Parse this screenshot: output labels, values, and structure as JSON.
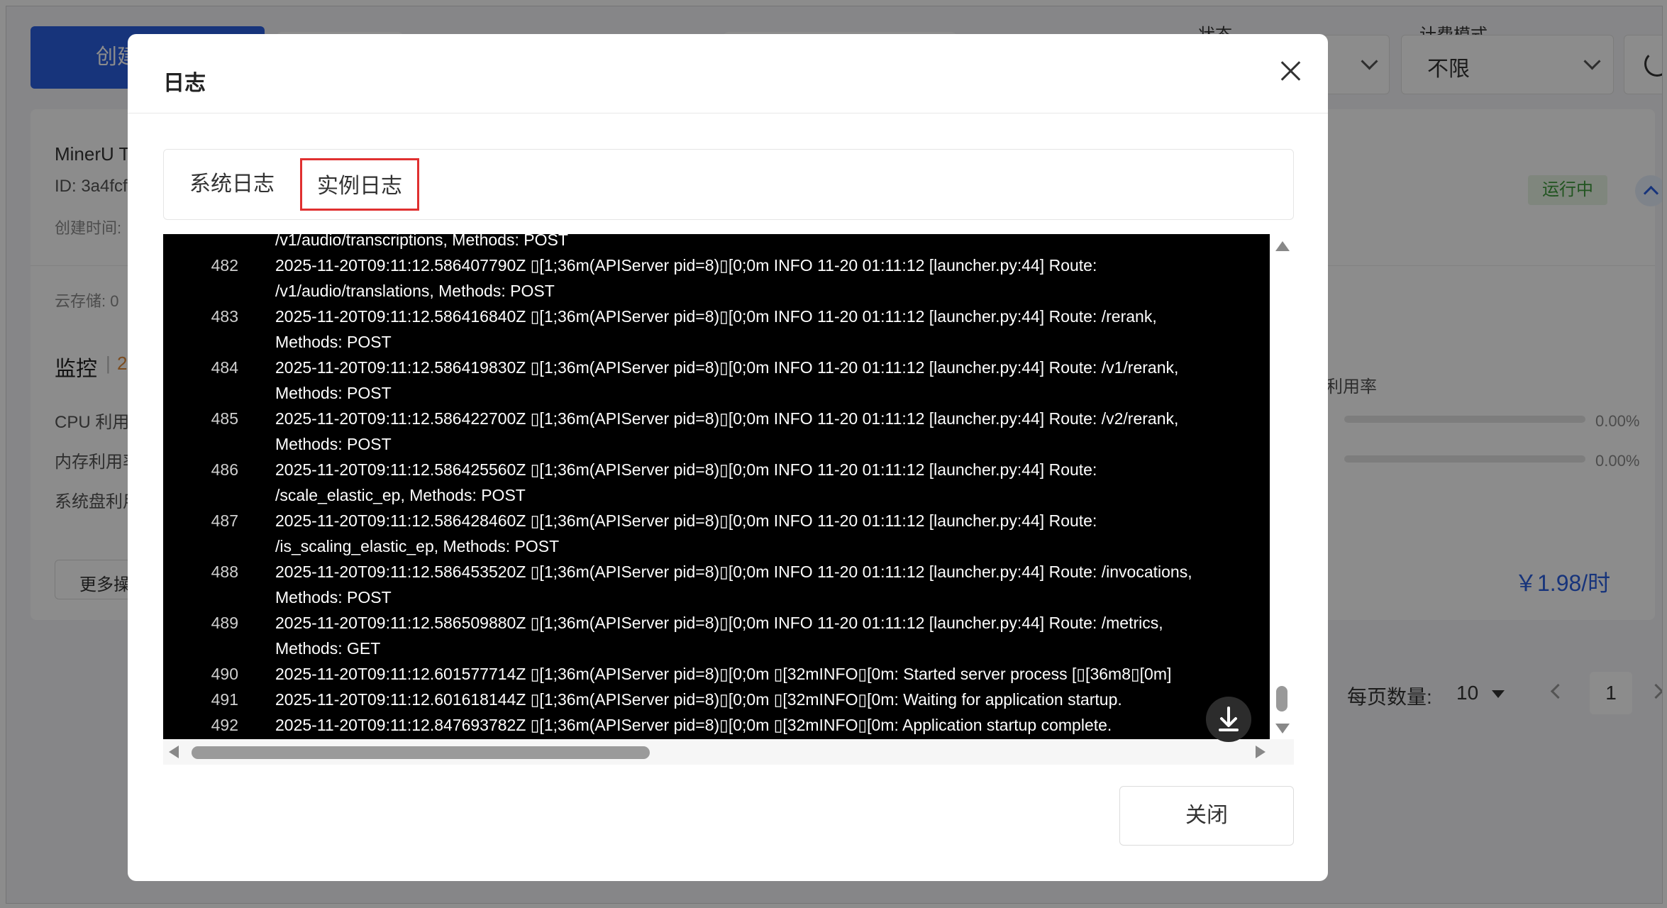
{
  "background": {
    "create_button": "创建",
    "status_label": "状态",
    "billing_label": "计费模式",
    "billing_value": "不限",
    "instance_name": "MinerU T",
    "instance_id": "ID: 3a4fcf",
    "created_label": "创建时间:",
    "storage_label": "云存储: 0",
    "monitor_title": "监控",
    "monitor_sep": "|",
    "monitor_extra": "2",
    "cpu_label": "CPU 利用",
    "mem_label": "内存利用率",
    "disk_label": "系统盘利用",
    "more_ops": "更多操",
    "running_badge": "运行中",
    "usage_label": "利用率",
    "usage_1": "0.00%",
    "usage_2": "0.00%",
    "price": "￥1.98/时",
    "page_size_label": "每页数量:",
    "page_size_value": "10",
    "page_current": "1",
    "colors": {
      "primary": "#2b5fe0",
      "success": "#3d9a3b"
    }
  },
  "modal": {
    "title": "日志",
    "tabs": [
      {
        "label": "系统日志",
        "active": false
      },
      {
        "label": "实例日志",
        "active": true
      }
    ],
    "close_button": "关闭",
    "log_lines": [
      {
        "num": "",
        "text": "/v1/audio/transcriptions, Methods: POST"
      },
      {
        "num": "482",
        "text": "2025-11-20T09:11:12.586407790Z ▯[1;36m(APIServer pid=8)▯[0;0m INFO 11-20 01:11:12 [launcher.py:44] Route:"
      },
      {
        "num": "",
        "text": "/v1/audio/translations, Methods: POST"
      },
      {
        "num": "483",
        "text": "2025-11-20T09:11:12.586416840Z ▯[1;36m(APIServer pid=8)▯[0;0m INFO 11-20 01:11:12 [launcher.py:44] Route: /rerank,"
      },
      {
        "num": "",
        "text": "Methods: POST"
      },
      {
        "num": "484",
        "text": "2025-11-20T09:11:12.586419830Z ▯[1;36m(APIServer pid=8)▯[0;0m INFO 11-20 01:11:12 [launcher.py:44] Route: /v1/rerank,"
      },
      {
        "num": "",
        "text": "Methods: POST"
      },
      {
        "num": "485",
        "text": "2025-11-20T09:11:12.586422700Z ▯[1;36m(APIServer pid=8)▯[0;0m INFO 11-20 01:11:12 [launcher.py:44] Route: /v2/rerank,"
      },
      {
        "num": "",
        "text": "Methods: POST"
      },
      {
        "num": "486",
        "text": "2025-11-20T09:11:12.586425560Z ▯[1;36m(APIServer pid=8)▯[0;0m INFO 11-20 01:11:12 [launcher.py:44] Route:"
      },
      {
        "num": "",
        "text": "/scale_elastic_ep, Methods: POST"
      },
      {
        "num": "487",
        "text": "2025-11-20T09:11:12.586428460Z ▯[1;36m(APIServer pid=8)▯[0;0m INFO 11-20 01:11:12 [launcher.py:44] Route:"
      },
      {
        "num": "",
        "text": "/is_scaling_elastic_ep, Methods: POST"
      },
      {
        "num": "488",
        "text": "2025-11-20T09:11:12.586453520Z ▯[1;36m(APIServer pid=8)▯[0;0m INFO 11-20 01:11:12 [launcher.py:44] Route: /invocations,"
      },
      {
        "num": "",
        "text": "Methods: POST"
      },
      {
        "num": "489",
        "text": "2025-11-20T09:11:12.586509880Z ▯[1;36m(APIServer pid=8)▯[0;0m INFO 11-20 01:11:12 [launcher.py:44] Route: /metrics,"
      },
      {
        "num": "",
        "text": "Methods: GET"
      },
      {
        "num": "490",
        "text": "2025-11-20T09:11:12.601577714Z ▯[1;36m(APIServer pid=8)▯[0;0m ▯[32mINFO▯[0m: Started server process [▯[36m8▯[0m]"
      },
      {
        "num": "491",
        "text": "2025-11-20T09:11:12.601618144Z ▯[1;36m(APIServer pid=8)▯[0;0m ▯[32mINFO▯[0m: Waiting for application startup."
      },
      {
        "num": "492",
        "text": "2025-11-20T09:11:12.847693782Z ▯[1;36m(APIServer pid=8)▯[0;0m ▯[32mINFO▯[0m: Application startup complete."
      }
    ]
  }
}
